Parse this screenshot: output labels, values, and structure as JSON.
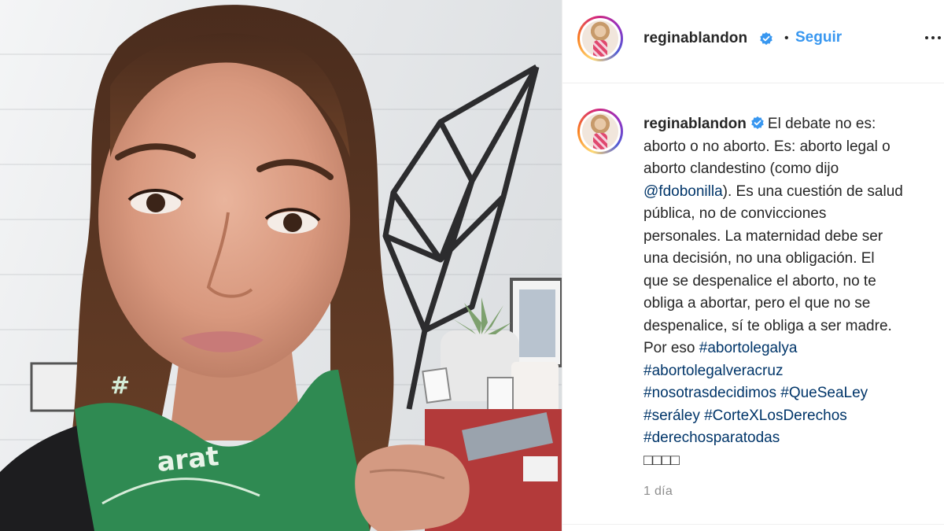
{
  "post": {
    "username": "reginablandon",
    "follow_label": "Seguir",
    "separator": "•",
    "caption": {
      "line1": "El debate no es:",
      "line2": "aborto o no aborto. Es: aborto legal o",
      "line3a": "aborto clandestino (como dijo",
      "mention": "@fdobonilla",
      "line4b": "). Es una cuestión de salud",
      "line5": "pública, no de convicciones",
      "line6": "personales. La maternidad debe ser",
      "line7": "una decisión, no una obligación. El",
      "line8": "que se despenalice el aborto, no te",
      "line9": "obliga a abortar, pero el que no se",
      "line10": "despenalice, sí te obliga a ser madre.",
      "line11a": "Por eso ",
      "tags": {
        "t1": "#abortolegalya",
        "t2": "#abortolegalveracruz",
        "t3": "#nosotrasdecidimos",
        "t4": "#QueSeaLey",
        "t5": "#seráley",
        "t6": "#CorteXLosDerechos",
        "t7": "#derechosparatodas"
      },
      "emoji_placeholder": "□□□□"
    },
    "timestamp": "1 día"
  },
  "photo": {
    "bandana_text": "arat"
  },
  "colors": {
    "link": "#003569",
    "follow": "#3897f0",
    "verified": "#3897f0",
    "text": "#262626",
    "muted": "#8e8e8e",
    "bandana": "#2f8a52"
  },
  "icons": {
    "verified": "verified-badge-icon",
    "more": "more-options-icon"
  }
}
